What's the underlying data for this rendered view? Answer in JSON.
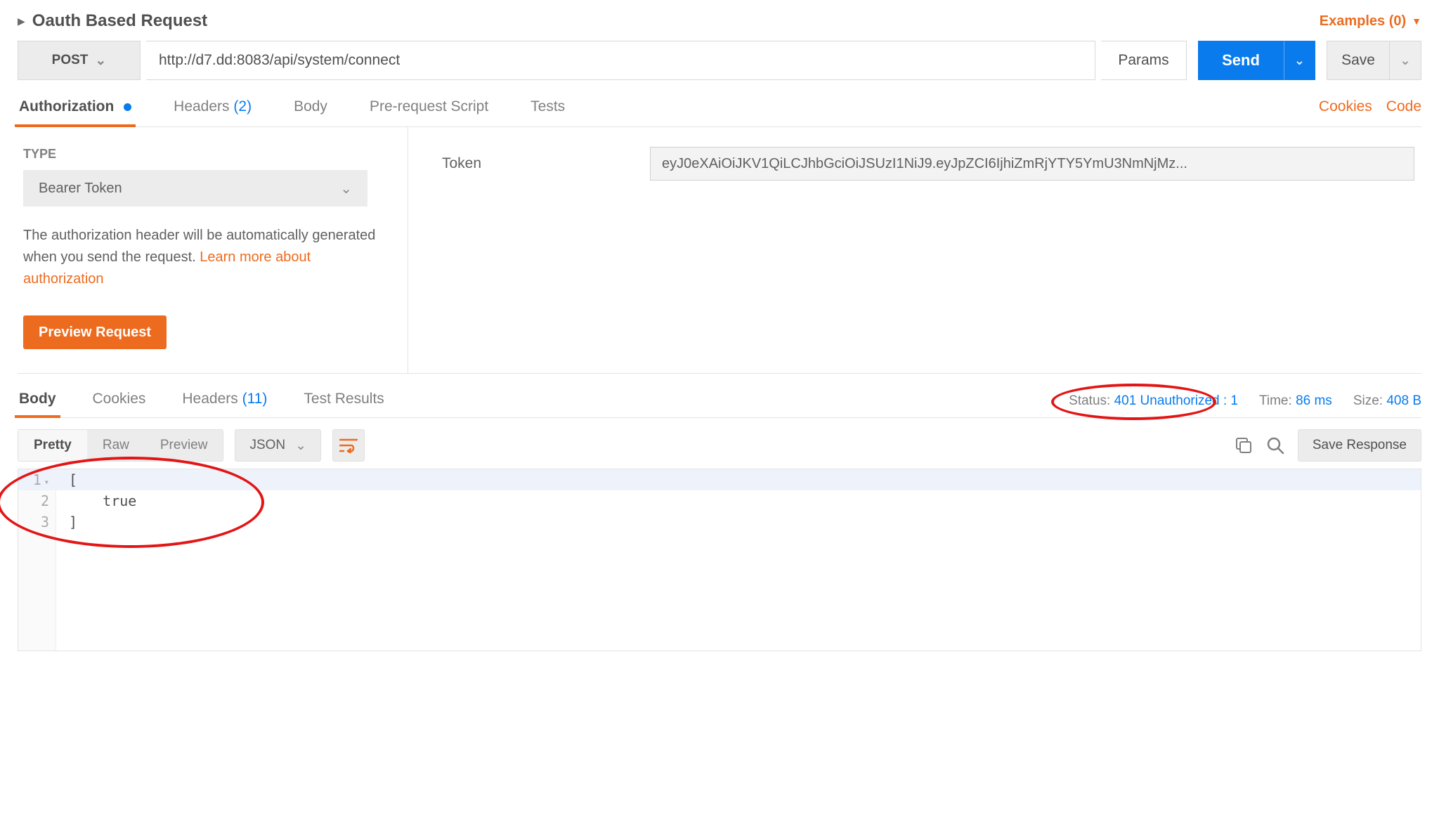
{
  "header": {
    "request_title": "Oauth Based Request",
    "examples_label": "Examples (0)"
  },
  "request": {
    "method": "POST",
    "url": "http://d7.dd:8083/api/system/connect",
    "params_label": "Params",
    "send_label": "Send",
    "save_label": "Save"
  },
  "tabs": {
    "authorization": "Authorization",
    "headers": "Headers",
    "headers_count": "(2)",
    "body": "Body",
    "prerequest": "Pre-request Script",
    "tests": "Tests",
    "cookies_link": "Cookies",
    "code_link": "Code"
  },
  "auth": {
    "type_label": "TYPE",
    "type_value": "Bearer Token",
    "hint_text": "The authorization header will be automatically generated when you send the request. ",
    "hint_link": "Learn more about authorization",
    "preview_label": "Preview Request",
    "token_label": "Token",
    "token_value": "eyJ0eXAiOiJKV1QiLCJhbGciOiJSUzI1NiJ9.eyJpZCI6IjhiZmRjYTY5YmU3NmNjMz..."
  },
  "response": {
    "tabs": {
      "body": "Body",
      "cookies": "Cookies",
      "headers": "Headers",
      "headers_count": "(11)",
      "tests": "Test Results"
    },
    "meta": {
      "status_label": "Status:",
      "status_value": "401 Unauthorized : 1",
      "time_label": "Time:",
      "time_value": "86 ms",
      "size_label": "Size:",
      "size_value": "408 B"
    },
    "toolbar": {
      "pretty": "Pretty",
      "raw": "Raw",
      "preview": "Preview",
      "format": "JSON",
      "save_response": "Save Response"
    },
    "body_lines": {
      "l1": "[",
      "l2": "    true",
      "l3": "]"
    }
  }
}
